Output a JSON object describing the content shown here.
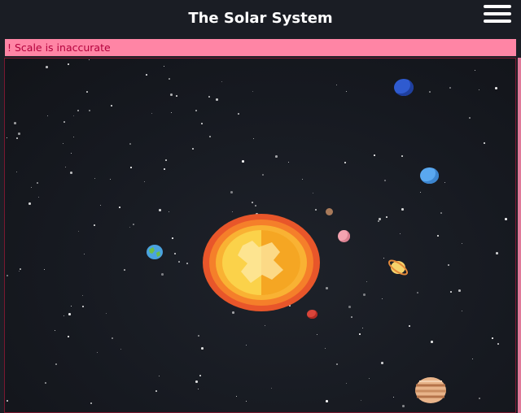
{
  "header": {
    "title": "The Solar System",
    "menu_icon": "hamburger-menu-icon"
  },
  "notice": {
    "text": "! Scale is inaccurate",
    "color": "#ff85a5"
  },
  "scene": {
    "objects": [
      "sun",
      "mercury",
      "venus",
      "earth",
      "mars",
      "jupiter",
      "saturn",
      "uranus",
      "neptune"
    ]
  }
}
